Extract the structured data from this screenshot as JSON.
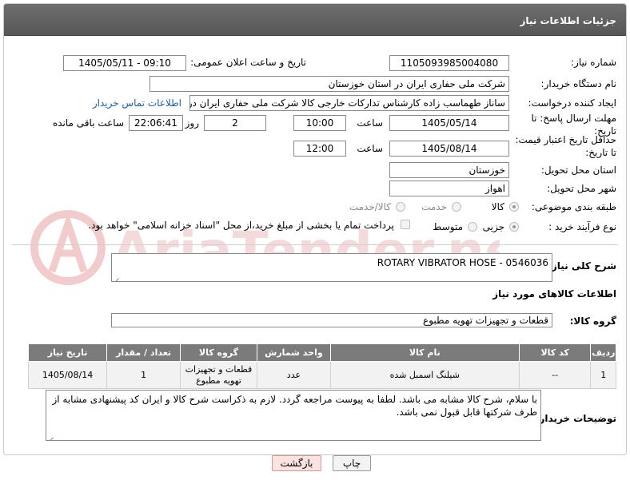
{
  "header": {
    "title": "جزئیات اطلاعات نیاز"
  },
  "form": {
    "need_number_label": "شماره نیاز:",
    "need_number": "1105093985004080",
    "announce_label": "تاریخ و ساعت اعلان عمومی:",
    "announce_value": "1405/05/11 - 09:10",
    "buyer_label": "نام دستگاه خریدار:",
    "buyer_value": "شرکت ملی حفاری ایران در استان خوزستان",
    "creator_label": "ایجاد کننده درخواست:",
    "creator_value": "ساناز طهماسب زاده کارشناس تدارکات خارجی کالا شرکت ملی حفاری ایران در",
    "contact_link": "اطلاعات تماس خریدار",
    "deadline_label_1": "مهلت ارسال پاسخ: تا",
    "deadline_label_2": "تاریخ:",
    "deadline_date": "1405/05/14",
    "time_word": "ساعت",
    "deadline_time": "10:00",
    "days_value": "2",
    "days_word": "روز و",
    "remaining_time": "22:06:41",
    "remaining_word": "ساعت باقی مانده",
    "validity_label_1": "حداقل تاریخ اعتبار قیمت:",
    "validity_label_2": "تا تاریخ:",
    "validity_date": "1405/08/14",
    "validity_time": "12:00",
    "province_label": "استان محل تحویل:",
    "province_value": "خوزستان",
    "city_label": "شهر محل تحویل:",
    "city_value": "اهواز",
    "category_label": "طبقه بندی موضوعی:",
    "category_options": [
      "کالا",
      "خدمت",
      "کالا/خدمت"
    ],
    "purchase_label": "نوع فرآیند خرید :",
    "purchase_options": [
      "جزیی",
      "متوسط"
    ],
    "payment_note": "پرداخت تمام یا بخشی از مبلغ خرید،از محل \"اسناد خزانه اسلامی\" خواهد بود."
  },
  "summary": {
    "label": "شرح کلی نیاز:",
    "value": "ROTARY VIBRATOR HOSE - 0546036"
  },
  "goods_section": {
    "title": "اطلاعات کالاهای مورد نیاز",
    "group_label": "گروه کالا:",
    "group_value": "قطعات و تجهیزات تهویه مطبوع"
  },
  "table": {
    "headers": [
      "ردیف",
      "کد کالا",
      "نام کالا",
      "واحد شمارش",
      "گروه کالا",
      "تعداد / مقدار",
      "تاریخ نیاز"
    ],
    "rows": [
      {
        "row": "1",
        "code": "--",
        "name": "شیلنگ اسمبل شده",
        "unit": "عدد",
        "group": "قطعات و تجهیزات تهویه مطبوع",
        "qty": "1",
        "date": "1405/08/14"
      }
    ]
  },
  "buyer_notes": {
    "label": "توضیحات خریدار:",
    "value": "با سلام، شرح کالا مشابه می باشد. لطفا به پیوست مراجعه گردد. لازم به ذکراست شرح کالا و ایران کد  پیشنهادی مشابه از طرف شرکتها قابل قبول نمی باشد."
  },
  "buttons": {
    "print": "چاپ",
    "back": "بازگشت"
  },
  "watermark": {
    "text": "AriaTender.neT"
  },
  "colors": {
    "header_bg": "#5f5f5f",
    "table_header_bg": "#7b7b7b",
    "link": "#1a5fb4",
    "back_button_bg": "#fde2e2"
  }
}
